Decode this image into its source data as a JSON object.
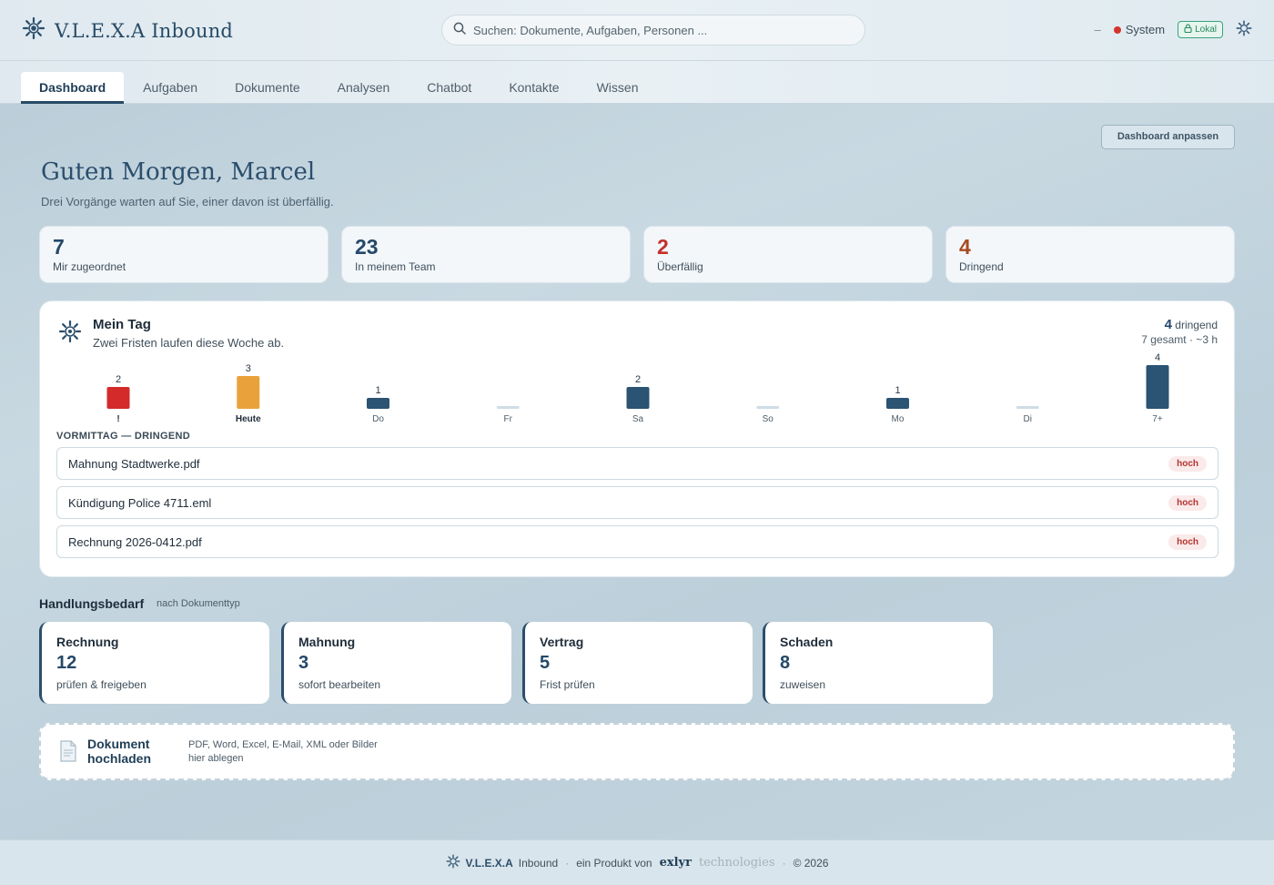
{
  "app": {
    "title": "V.L.E.X.A Inbound"
  },
  "search": {
    "placeholder": "Suchen: Dokumente, Aufgaben, Personen ..."
  },
  "status": {
    "dash": "–",
    "system_label": "System",
    "system_color": "#d6332e",
    "local_label": "Lokal"
  },
  "tabs": [
    {
      "label": "Dashboard",
      "active": true
    },
    {
      "label": "Aufgaben"
    },
    {
      "label": "Dokumente"
    },
    {
      "label": "Analysen"
    },
    {
      "label": "Chatbot"
    },
    {
      "label": "Kontakte"
    },
    {
      "label": "Wissen"
    }
  ],
  "header": {
    "customize_label": "Dashboard anpassen",
    "greeting": "Guten Morgen, Marcel",
    "subtitle": "Drei Vorgänge warten auf Sie, einer davon ist überfällig."
  },
  "kpis": [
    {
      "value": "7",
      "label": "Mir zugeordnet"
    },
    {
      "value": "23",
      "label": "In meinem Team"
    },
    {
      "value": "2",
      "label": "Überfällig"
    },
    {
      "value": "4",
      "label": "Dringend"
    }
  ],
  "my_day": {
    "title": "Mein Tag",
    "subtitle": "Zwei Fristen laufen diese Woche ab.",
    "urgent_count": "4",
    "urgent_label": "dringend",
    "total_text": "7 gesamt · ~3 h",
    "section_label": "VORMITTAG — DRINGEND",
    "tasks": [
      {
        "name": "Mahnung Stadtwerke.pdf",
        "priority": "hoch"
      },
      {
        "name": "Kündigung Police 4711.eml",
        "priority": "hoch"
      },
      {
        "name": "Rechnung 2026-0412.pdf",
        "priority": "hoch"
      }
    ]
  },
  "chart_data": {
    "type": "bar",
    "categories": [
      "!",
      "Heute",
      "Do",
      "Fr",
      "Sa",
      "So",
      "Mo",
      "Di",
      "7+"
    ],
    "values": [
      2,
      3,
      1,
      0,
      2,
      0,
      1,
      0,
      4
    ],
    "colors": [
      "#d42a2a",
      "#e9a23b",
      "#2b5373",
      "#cfdde6",
      "#2b5373",
      "#cfdde6",
      "#2b5373",
      "#cfdde6",
      "#2b5373"
    ],
    "bold_categories": [
      "!",
      "Heute"
    ]
  },
  "needs": {
    "title": "Handlungsbedarf",
    "subtitle": "nach Dokumenttyp",
    "cards": [
      {
        "title": "Rechnung",
        "value": "12",
        "action": "prüfen & freigeben"
      },
      {
        "title": "Mahnung",
        "value": "3",
        "action": "sofort bearbeiten"
      },
      {
        "title": "Vertrag",
        "value": "5",
        "action": "Frist prüfen"
      },
      {
        "title": "Schaden",
        "value": "8",
        "action": "zuweisen"
      }
    ]
  },
  "upload": {
    "title": "Dokument hochladen",
    "description": "PDF, Word, Excel, E-Mail, XML oder Bilder hier ablegen"
  },
  "footer": {
    "brand": "V.L.E.X.A",
    "brand_suffix": "Inbound",
    "product_of": "ein Produkt von",
    "company": "exlyr",
    "company_suffix": "technologies",
    "copyright": "© 2026"
  }
}
